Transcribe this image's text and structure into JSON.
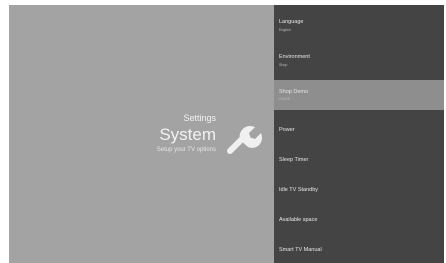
{
  "hero": {
    "section": "Settings",
    "title": "System",
    "description": "Setup your TV options",
    "icon": "wrench-icon"
  },
  "menu": {
    "items": [
      {
        "label": "Language",
        "value": "English"
      },
      {
        "label": "Environment",
        "value": "Shop"
      },
      {
        "label": "Shop Demo",
        "value": "On/Off",
        "selected": true
      },
      {
        "label": "Power"
      },
      {
        "label": "Sleep Timer"
      },
      {
        "label": "Idle TV Standby"
      },
      {
        "label": "Available space"
      },
      {
        "label": "Smart TV Manual"
      }
    ]
  },
  "colors": {
    "hero_background": "#a3a3a3",
    "menu_background": "#444444",
    "selected_item": "#8e8e8e",
    "text": "#f2f2f2"
  }
}
